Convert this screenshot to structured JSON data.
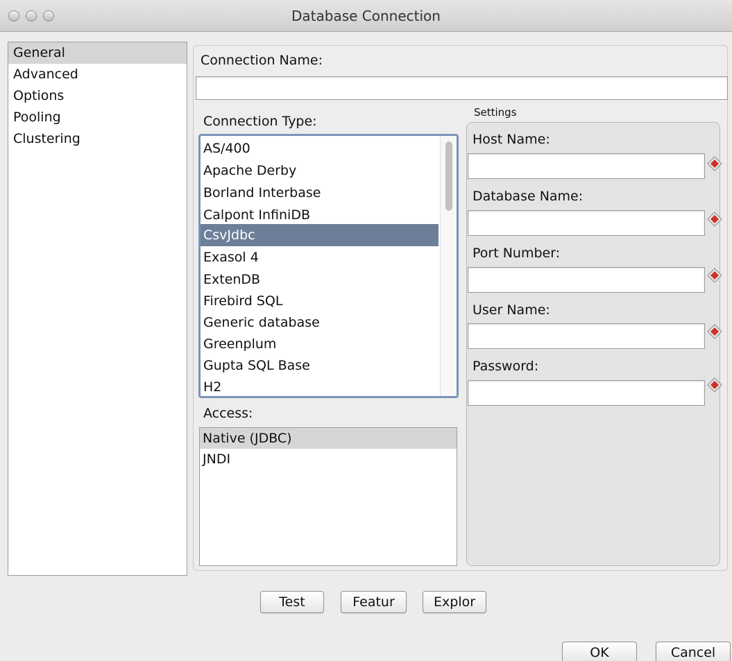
{
  "window": {
    "title": "Database Connection"
  },
  "nav": {
    "items": [
      "General",
      "Advanced",
      "Options",
      "Pooling",
      "Clustering"
    ],
    "selected": "General"
  },
  "connection_name": {
    "label": "Connection Name:",
    "value": ""
  },
  "connection_type": {
    "label": "Connection Type:",
    "items": [
      "AS/400",
      "Apache Derby",
      "Borland Interbase",
      "Calpont InfiniDB",
      "CsvJdbc",
      "Exasol 4",
      "ExtenDB",
      "Firebird SQL",
      "Generic database",
      "Greenplum",
      "Gupta SQL Base",
      "H2"
    ],
    "selected": "CsvJdbc"
  },
  "access": {
    "label": "Access:",
    "items": [
      "Native (JDBC)",
      "JNDI"
    ],
    "selected": "Native (JDBC)"
  },
  "settings": {
    "title": "Settings",
    "fields": [
      {
        "label": "Host Name:",
        "value": ""
      },
      {
        "label": "Database Name:",
        "value": ""
      },
      {
        "label": "Port Number:",
        "value": ""
      },
      {
        "label": "User Name:",
        "value": ""
      },
      {
        "label": "Password:",
        "value": ""
      }
    ]
  },
  "buttons": {
    "test": "Test",
    "feature": "Featur",
    "explore": "Explor",
    "ok": "OK",
    "cancel": "Cancel"
  },
  "colors": {
    "list_selection": "#6d7f98",
    "required_icon": "#d0312d"
  }
}
